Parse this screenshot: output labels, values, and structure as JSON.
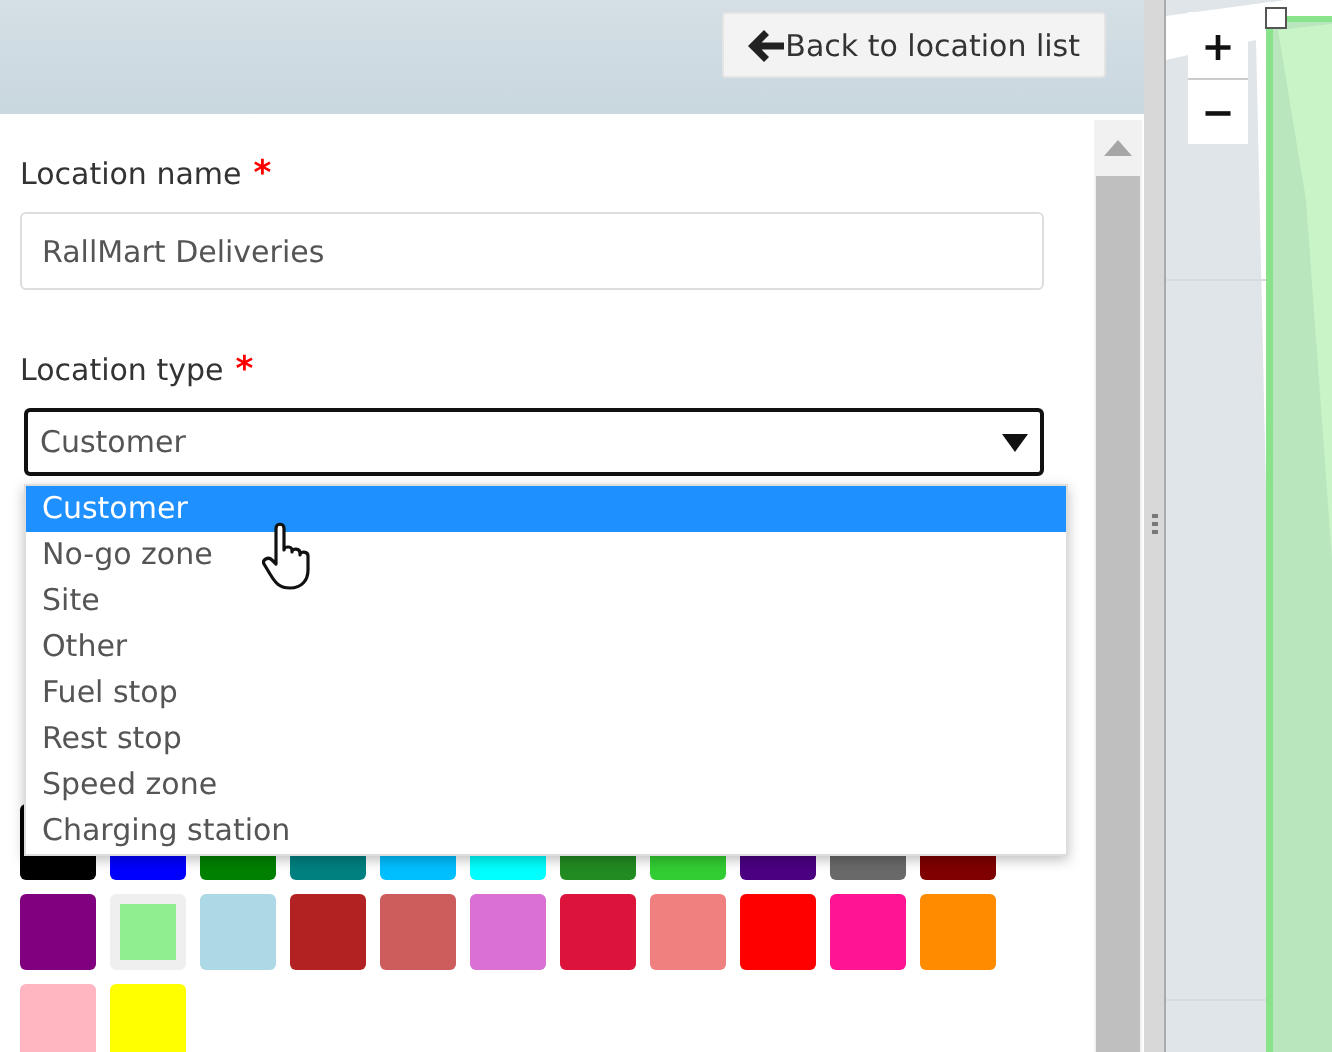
{
  "header": {
    "back_button": "Back to location list"
  },
  "fields": [
    {
      "kind": "text",
      "label": "Location name",
      "required_mark": "*",
      "value": "RallMart Deliveries"
    },
    {
      "kind": "select",
      "label": "Location type",
      "required_mark": "*",
      "value": "Customer",
      "expanded": true,
      "options": [
        {
          "label": "Customer",
          "selected": true
        },
        {
          "label": "No-go zone",
          "selected": false
        },
        {
          "label": "Site",
          "selected": false
        },
        {
          "label": "Other",
          "selected": false
        },
        {
          "label": "Fuel stop",
          "selected": false
        },
        {
          "label": "Rest stop",
          "selected": false
        },
        {
          "label": "Speed zone",
          "selected": false
        },
        {
          "label": "Charging station",
          "selected": false
        }
      ]
    }
  ],
  "swatches": [
    {
      "color": "#000000",
      "selected": false
    },
    {
      "color": "#0000ff",
      "selected": false
    },
    {
      "color": "#008000",
      "selected": false
    },
    {
      "color": "#008080",
      "selected": false
    },
    {
      "color": "#00bfff",
      "selected": false
    },
    {
      "color": "#00ffff",
      "selected": false
    },
    {
      "color": "#228b22",
      "selected": false
    },
    {
      "color": "#32cd32",
      "selected": false
    },
    {
      "color": "#4b0082",
      "selected": false
    },
    {
      "color": "#696969",
      "selected": false
    },
    {
      "color": "#800000",
      "selected": false
    },
    {
      "color": "#800080",
      "selected": false
    },
    {
      "color": "#90ee90",
      "selected": true
    },
    {
      "color": "#add8e6",
      "selected": false
    },
    {
      "color": "#b22222",
      "selected": false
    },
    {
      "color": "#cd5c5c",
      "selected": false
    },
    {
      "color": "#da70d6",
      "selected": false
    },
    {
      "color": "#dc143c",
      "selected": false
    },
    {
      "color": "#f08080",
      "selected": false
    },
    {
      "color": "#ff0000",
      "selected": false
    },
    {
      "color": "#ff1493",
      "selected": false
    },
    {
      "color": "#ff8c00",
      "selected": false
    },
    {
      "color": "#ffb6c1",
      "selected": false
    },
    {
      "color": "#ffff00",
      "selected": false
    }
  ],
  "map": {
    "zoom_in": "+",
    "zoom_out": "−"
  }
}
